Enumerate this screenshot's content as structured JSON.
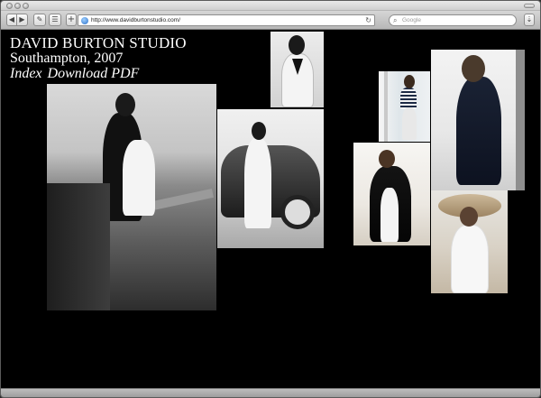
{
  "browser": {
    "url": "http://www.davidburtonstudio.com/",
    "search_placeholder": "Google",
    "icons": {
      "back": "triangle-left",
      "forward": "triangle-right",
      "reload": "circular-arrow",
      "search": "magnifier",
      "add": "plus",
      "download": "down-arrow"
    }
  },
  "site": {
    "title": "DAVID BURTON STUDIO",
    "location": "Southampton, 2007",
    "nav": {
      "index": "Index",
      "download_pdf": "Download PDF"
    }
  },
  "photos": [
    {
      "name": "photo-boardwalk-coat",
      "tone": "bw"
    },
    {
      "name": "photo-vneck-sweater",
      "tone": "bw"
    },
    {
      "name": "photo-vintage-car",
      "tone": "bw"
    },
    {
      "name": "photo-window-stripes",
      "tone": "color"
    },
    {
      "name": "photo-navy-top",
      "tone": "color"
    },
    {
      "name": "photo-beach-cardigan",
      "tone": "color"
    },
    {
      "name": "photo-sun-hat",
      "tone": "color"
    }
  ]
}
